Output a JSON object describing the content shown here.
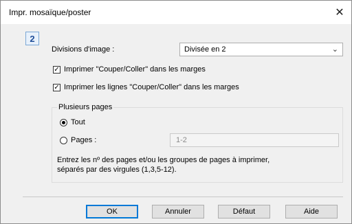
{
  "window": {
    "title": "Impr. mosaïque/poster",
    "close_glyph": "✕"
  },
  "page_number_badge": "2",
  "divisions": {
    "label": "Divisions d'image :",
    "selected": "Divisée en 2",
    "chevron": "⌄"
  },
  "checkboxes": [
    {
      "label": "Imprimer \"Couper/Coller\" dans les marges",
      "checked": true
    },
    {
      "label": "Imprimer les lignes \"Couper/Coller\" dans les marges",
      "checked": true
    }
  ],
  "pages_group": {
    "title": "Plusieurs pages",
    "radio_all": "Tout",
    "radio_pages": "Pages :",
    "pages_value": "1-2",
    "note_line1": "Entrez les nº des pages et/ou les groupes de pages à imprimer,",
    "note_line2": "séparés par des virgules (1,3,5-12)."
  },
  "buttons": {
    "ok": "OK",
    "cancel": "Annuler",
    "default": "Défaut",
    "help": "Aide"
  },
  "icons": {
    "check": "✓"
  }
}
